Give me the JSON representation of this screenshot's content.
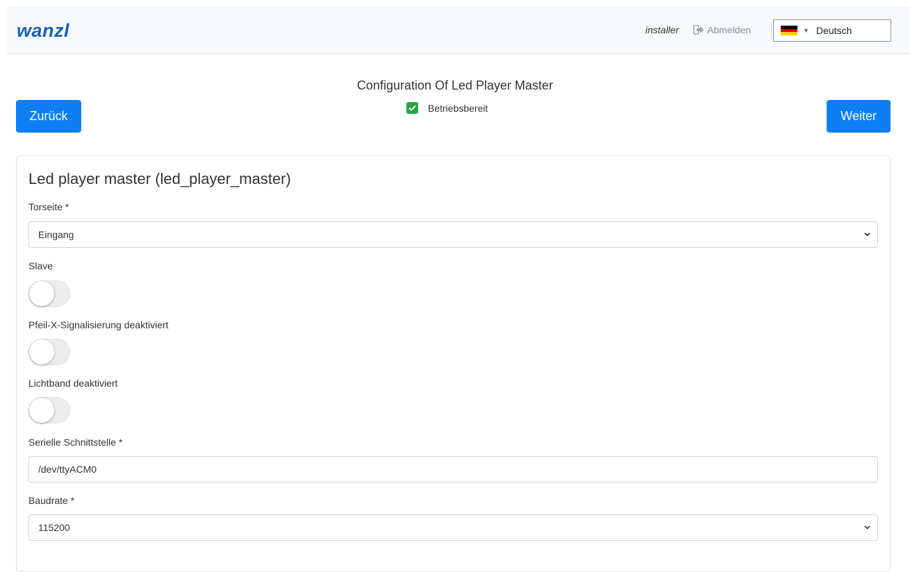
{
  "header": {
    "logo": "wanzl",
    "user": "installer",
    "logout_label": "Abmelden",
    "language": "Deutsch",
    "flag_colors": [
      "#000000",
      "#dd0000",
      "#ffce00"
    ]
  },
  "page": {
    "title": "Configuration Of Led Player Master",
    "status_label": "Betriebsbereit",
    "status_color": "#28a745",
    "back_label": "Zurück",
    "next_label": "Weiter",
    "accent_color": "#0d7ff3"
  },
  "form": {
    "title": "Led player master (led_player_master)",
    "torseite_label": "Torseite *",
    "torseite_value": "Eingang",
    "slave_label": "Slave",
    "slave_on": false,
    "pfeil_label": "Pfeil-X-Signalisierung deaktiviert",
    "pfeil_on": false,
    "lichtband_label": "Lichtband deaktiviert",
    "lichtband_on": false,
    "serial_label": "Serielle Schnittstelle *",
    "serial_value": "/dev/ttyACM0",
    "baudrate_label": "Baudrate *",
    "baudrate_value": "115200"
  }
}
